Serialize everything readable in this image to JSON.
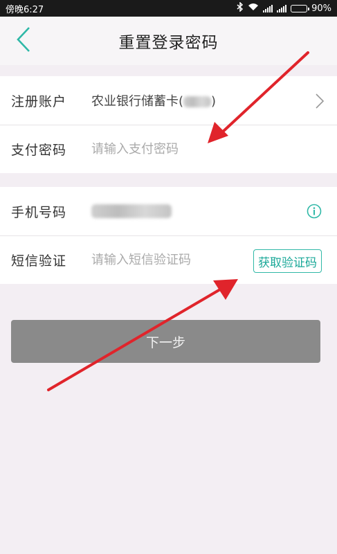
{
  "status_bar": {
    "time": "傍晚6:27",
    "battery": "90%",
    "battery_level": 0.9
  },
  "header": {
    "title": "重置登录密码"
  },
  "account_section": {
    "register_label": "注册账户",
    "register_value": "农业银行储蓄卡(",
    "register_value_close": ")",
    "pay_password_label": "支付密码",
    "pay_password_placeholder": "请输入支付密码"
  },
  "verify_section": {
    "phone_label": "手机号码",
    "sms_label": "短信验证",
    "sms_placeholder": "请输入短信验证码",
    "get_code_button": "获取验证码"
  },
  "next_button": "下一步",
  "colors": {
    "accent": "#2fb8a7",
    "annotation_arrow": "#e0242b",
    "disabled_button": "#8a8a8a"
  },
  "icons": [
    "back-arrow-icon",
    "chevron-right-icon",
    "info-icon",
    "wifi-icon",
    "bluetooth-icon",
    "signal-icon",
    "battery-icon"
  ]
}
